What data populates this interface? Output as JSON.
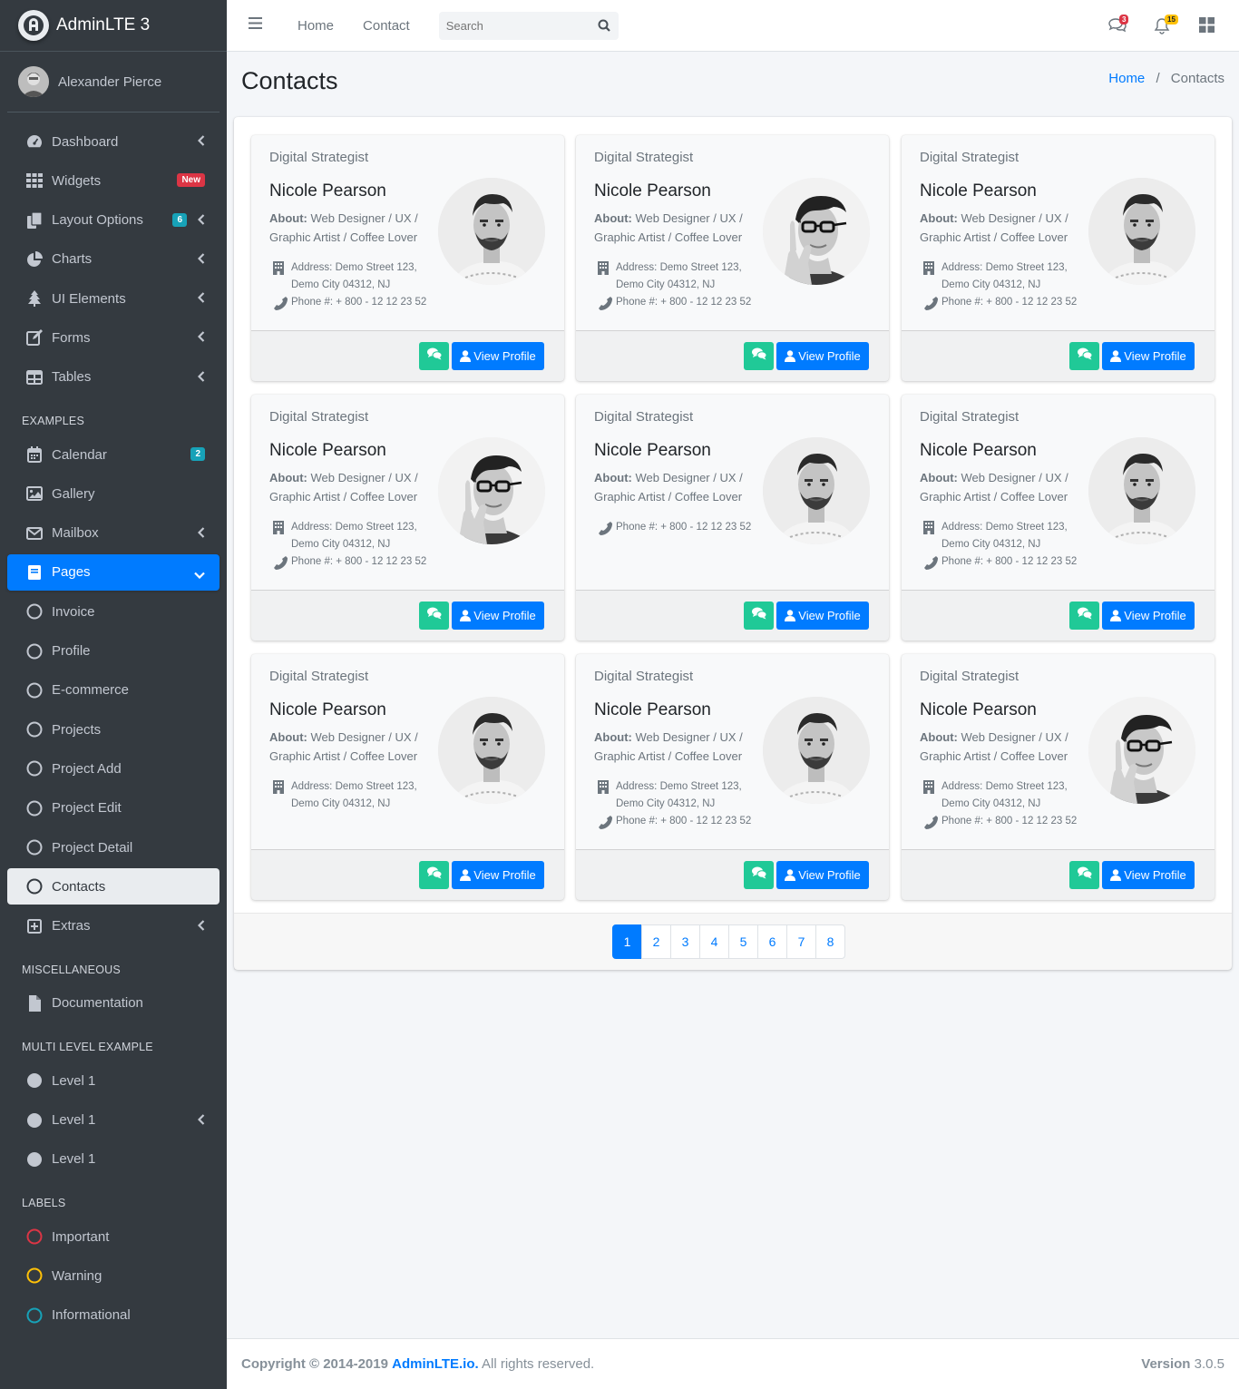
{
  "brand": {
    "title": "AdminLTE 3"
  },
  "user": {
    "name": "Alexander Pierce"
  },
  "sidebar": {
    "main_items": [
      {
        "label": "Dashboard"
      },
      {
        "label": "Widgets",
        "badge": "New"
      },
      {
        "label": "Layout Options",
        "badge": "6"
      },
      {
        "label": "Charts"
      },
      {
        "label": "UI Elements"
      },
      {
        "label": "Forms"
      },
      {
        "label": "Tables"
      }
    ],
    "examples_header": "EXAMPLES",
    "example_items": [
      {
        "label": "Calendar",
        "badge": "2"
      },
      {
        "label": "Gallery"
      },
      {
        "label": "Mailbox"
      },
      {
        "label": "Pages"
      },
      {
        "label": "Invoice"
      },
      {
        "label": "Profile"
      },
      {
        "label": "E-commerce"
      },
      {
        "label": "Projects"
      },
      {
        "label": "Project Add"
      },
      {
        "label": "Project Edit"
      },
      {
        "label": "Project Detail"
      },
      {
        "label": "Contacts"
      },
      {
        "label": "Extras"
      }
    ],
    "misc_header": "MISCELLANEOUS",
    "misc_items": [
      {
        "label": "Documentation"
      }
    ],
    "multi_header": "MULTI LEVEL EXAMPLE",
    "multi_items": [
      {
        "label": "Level 1"
      },
      {
        "label": "Level 1"
      },
      {
        "label": "Level 1"
      }
    ],
    "labels_header": "LABELS",
    "label_items": [
      {
        "label": "Important",
        "color": "#dc3545"
      },
      {
        "label": "Warning",
        "color": "#ffc107"
      },
      {
        "label": "Informational",
        "color": "#17a2b8"
      }
    ]
  },
  "topnav": {
    "home": "Home",
    "contact": "Contact",
    "search_placeholder": "Search",
    "messages_count": "3",
    "notifications_count": "15"
  },
  "page": {
    "title": "Contacts",
    "breadcrumb_home": "Home",
    "breadcrumb_current": "Contacts"
  },
  "contacts": [
    {
      "role": "Digital Strategist",
      "name": "Nicole Pearson",
      "about_label": "About:",
      "about": "Web Designer / UX / Graphic Artist / Coffee Lover",
      "address": "Address: Demo Street 123, Demo City 04312, NJ",
      "phone": "Phone #: + 800 - 12 12 23 52",
      "photo": "man-beard",
      "chat_icon": "comments-icon",
      "button": "View Profile"
    },
    {
      "role": "Digital Strategist",
      "name": "Nicole Pearson",
      "about_label": "About:",
      "about": "Web Designer / UX / Graphic Artist / Coffee Lover",
      "address": "Address: Demo Street 123, Demo City 04312, NJ",
      "phone": "Phone #: + 800 - 12 12 23 52",
      "photo": "man-glasses",
      "chat_icon": "comments-icon",
      "button": "View Profile"
    },
    {
      "role": "Digital Strategist",
      "name": "Nicole Pearson",
      "about_label": "About:",
      "about": "Web Designer / UX / Graphic Artist / Coffee Lover",
      "address": "Address: Demo Street 123, Demo City 04312, NJ",
      "phone": "Phone #: + 800 - 12 12 23 52",
      "photo": "man-beard",
      "chat_icon": "comments-icon",
      "button": "View Profile"
    },
    {
      "role": "Digital Strategist",
      "name": "Nicole Pearson",
      "about_label": "About:",
      "about": "Web Designer / UX / Graphic Artist / Coffee Lover",
      "address": "Address: Demo Street 123, Demo City 04312, NJ",
      "phone": "Phone #: + 800 - 12 12 23 52",
      "photo": "man-glasses",
      "chat_icon": "comments-icon",
      "button": "View Profile"
    },
    {
      "role": "Digital Strategist",
      "name": "Nicole Pearson",
      "about_label": "About:",
      "about": "Web Designer / UX / Graphic Artist / Coffee Lover",
      "address": "",
      "phone": "Phone #: + 800 - 12 12 23 52",
      "photo": "man-beard",
      "chat_icon": "comments-icon",
      "button": "View Profile"
    },
    {
      "role": "Digital Strategist",
      "name": "Nicole Pearson",
      "about_label": "About:",
      "about": "Web Designer / UX / Graphic Artist / Coffee Lover",
      "address": "Address: Demo Street 123, Demo City 04312, NJ",
      "phone": "Phone #: + 800 - 12 12 23 52",
      "photo": "man-beard",
      "chat_icon": "comments-icon",
      "button": "View Profile"
    },
    {
      "role": "Digital Strategist",
      "name": "Nicole Pearson",
      "about_label": "About:",
      "about": "Web Designer / UX / Graphic Artist / Coffee Lover",
      "address": "Address: Demo Street 123, Demo City 04312, NJ",
      "phone": "",
      "photo": "man-beard",
      "chat_icon": "comments-icon",
      "button": "View Profile"
    },
    {
      "role": "Digital Strategist",
      "name": "Nicole Pearson",
      "about_label": "About:",
      "about": "Web Designer / UX / Graphic Artist / Coffee Lover",
      "address": "Address: Demo Street 123, Demo City 04312, NJ",
      "phone": "Phone #: + 800 - 12 12 23 52",
      "photo": "man-beard",
      "chat_icon": "comments-icon",
      "button": "View Profile"
    },
    {
      "role": "Digital Strategist",
      "name": "Nicole Pearson",
      "about_label": "About:",
      "about": "Web Designer / UX / Graphic Artist / Coffee Lover",
      "address": "Address: Demo Street 123, Demo City 04312, NJ",
      "phone": "Phone #: + 800 - 12 12 23 52",
      "photo": "man-glasses",
      "chat_icon": "comments-icon",
      "button": "View Profile"
    }
  ],
  "pagination": [
    "1",
    "2",
    "3",
    "4",
    "5",
    "6",
    "7",
    "8"
  ],
  "footer": {
    "copyright": "Copyright © 2014-2019 ",
    "link": "AdminLTE.io.",
    "rights": " All rights reserved.",
    "version_label": "Version",
    "version": " 3.0.5"
  },
  "colors": {
    "primary": "#007bff",
    "success": "#20c997",
    "sidebar": "#343a40"
  }
}
